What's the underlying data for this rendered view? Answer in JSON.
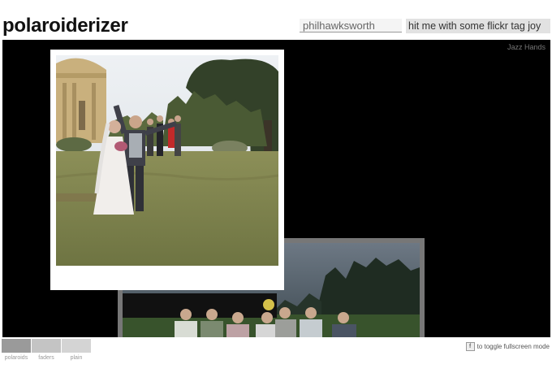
{
  "app": {
    "title": "polaroiderizer"
  },
  "search": {
    "value": "philhawksworth",
    "button_label": "hit me with some flickr tag joy"
  },
  "stage": {
    "caption": "Jazz Hands"
  },
  "modes": [
    {
      "label": "polaroids",
      "color": "#9a9a9a"
    },
    {
      "label": "faders",
      "color": "#c4c4c4"
    },
    {
      "label": "plain",
      "color": "#d4d4d4"
    }
  ],
  "fullscreen": {
    "key": "f",
    "hint": "to toggle fullscreen mode"
  },
  "colors": {
    "stage_bg": "#000000",
    "frame_white": "#ffffff",
    "frame_grey": "#777777"
  }
}
